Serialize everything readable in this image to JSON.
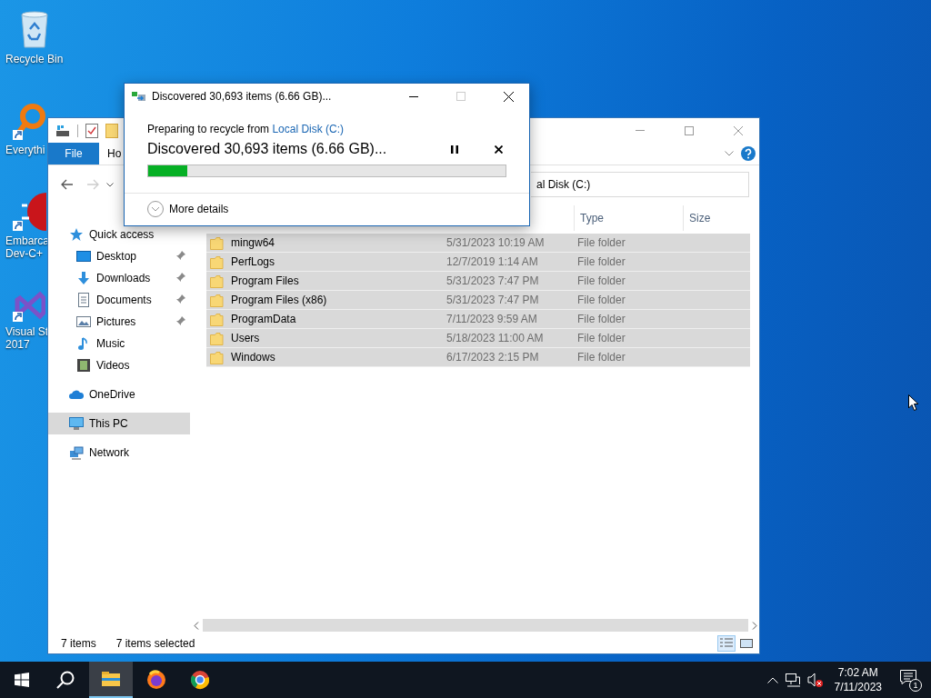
{
  "desktop_icons": [
    {
      "kind": "recycle-bin",
      "lines": [
        "Recycle Bin"
      ],
      "shortcut": false
    },
    {
      "kind": "magnifier",
      "lines": [
        "Everythi"
      ],
      "shortcut": true
    },
    {
      "kind": "dev",
      "lines": [
        "Embarca",
        "Dev-C+"
      ],
      "shortcut": true
    },
    {
      "kind": "visual-studio",
      "lines": [
        "Visual St",
        "2017"
      ],
      "shortcut": true
    }
  ],
  "explorer": {
    "ribbon_tabs": [
      {
        "label": "File",
        "kind": "file"
      },
      {
        "label": "Ho",
        "kind": "tab"
      }
    ],
    "address": "al Disk (C:)",
    "sidebar": [
      {
        "label": "Quick access",
        "kind": "star",
        "selected": false,
        "children": [
          {
            "label": "Desktop",
            "kind": "desktop",
            "pinned": true,
            "selected": false
          },
          {
            "label": "Downloads",
            "kind": "download",
            "pinned": true,
            "selected": false
          },
          {
            "label": "Documents",
            "kind": "document",
            "pinned": true,
            "selected": false
          },
          {
            "label": "Pictures",
            "kind": "picture",
            "pinned": true,
            "selected": false
          },
          {
            "label": "Music",
            "kind": "music",
            "pinned": false,
            "selected": false
          },
          {
            "label": "Videos",
            "kind": "video",
            "pinned": false,
            "selected": false
          }
        ]
      },
      {
        "label": "OneDrive",
        "kind": "cloud",
        "selected": false
      },
      {
        "label": "This PC",
        "kind": "computer",
        "selected": true
      },
      {
        "label": "Network",
        "kind": "network",
        "selected": false
      }
    ],
    "columns": [
      {
        "label": "Type"
      },
      {
        "label": "Size"
      }
    ],
    "rows": [
      {
        "name": "mingw64",
        "date": "5/31/2023 10:19 AM",
        "type": "File folder",
        "selected": true
      },
      {
        "name": "PerfLogs",
        "date": "12/7/2019 1:14 AM",
        "type": "File folder",
        "selected": true
      },
      {
        "name": "Program Files",
        "date": "5/31/2023 7:47 PM",
        "type": "File folder",
        "selected": true
      },
      {
        "name": "Program Files (x86)",
        "date": "5/31/2023 7:47 PM",
        "type": "File folder",
        "selected": true
      },
      {
        "name": "ProgramData",
        "date": "7/11/2023 9:59 AM",
        "type": "File folder",
        "selected": true
      },
      {
        "name": "Users",
        "date": "5/18/2023 11:00 AM",
        "type": "File folder",
        "selected": true
      },
      {
        "name": "Windows",
        "date": "6/17/2023 2:15 PM",
        "type": "File folder",
        "selected": true
      }
    ],
    "status_items": "7 items",
    "status_selection": "7 items selected",
    "views": [
      {
        "kind": "details",
        "selected": true
      },
      {
        "kind": "large-icons",
        "selected": false
      }
    ]
  },
  "dialog": {
    "title": "Discovered 30,693 items (6.66 GB)...",
    "status_prefix": "Preparing to recycle from",
    "source_link": "Local Disk (C:)",
    "heading": "Discovered 30,693 items (6.66 GB)...",
    "level": 0.11,
    "more_details": "More details"
  },
  "taskbar": {
    "apps": [
      {
        "kind": "explorer",
        "active": true
      },
      {
        "kind": "firefox",
        "active": false
      },
      {
        "kind": "chrome",
        "active": false
      }
    ],
    "volume_muted": true,
    "time": "7:02 AM",
    "date": "7/11/2023",
    "notification_count": "1"
  }
}
